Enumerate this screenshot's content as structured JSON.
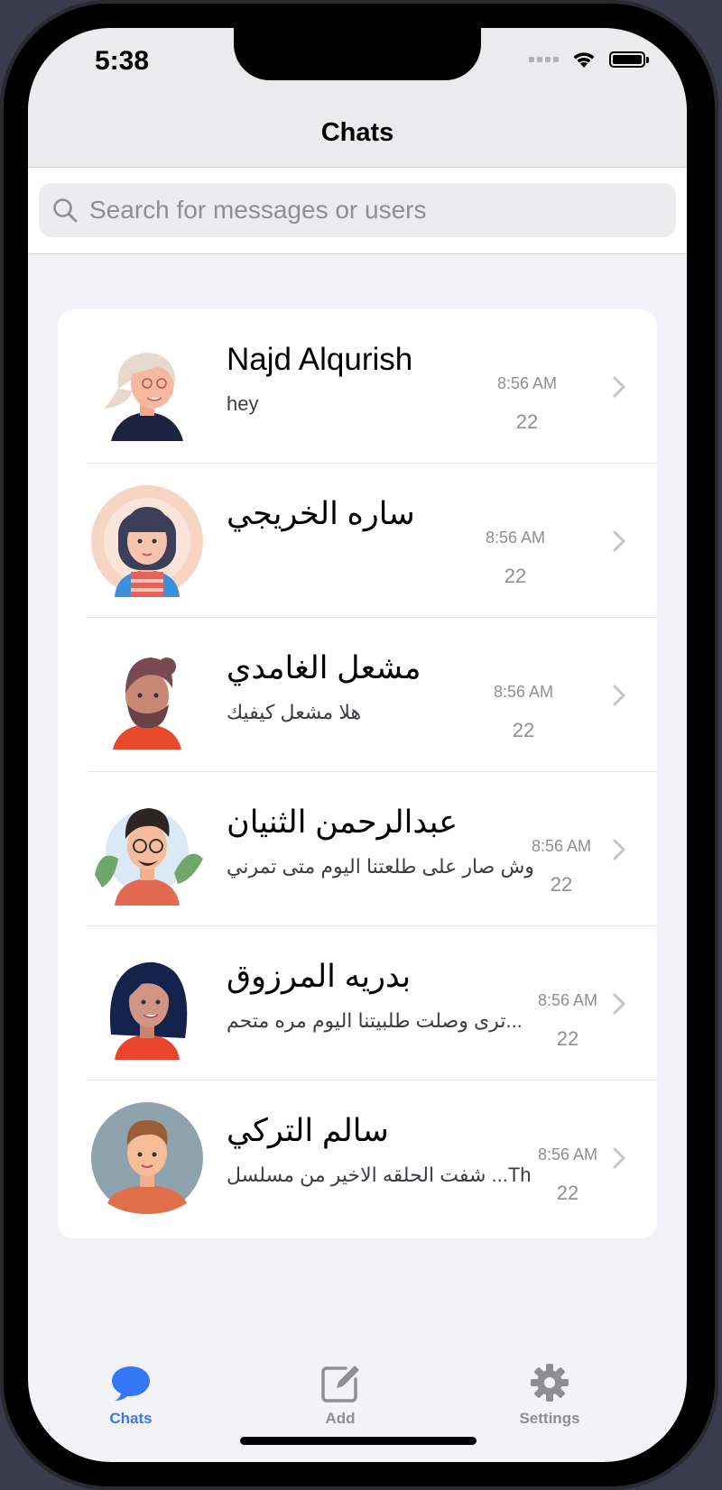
{
  "status_bar": {
    "time": "5:38"
  },
  "nav": {
    "title": "Chats"
  },
  "search": {
    "placeholder": "Search for messages or users"
  },
  "chats": [
    {
      "name": "Najd Alqurish",
      "message": "hey",
      "time": "8:56 AM",
      "count": "22",
      "avatar": "avatar-woman-blonde"
    },
    {
      "name": "ساره الخريجي",
      "message": "",
      "time": "8:56 AM",
      "count": "22",
      "avatar": "avatar-girl-bangs"
    },
    {
      "name": "مشعل الغامدي",
      "message": "هلا مشعل كيفيك",
      "time": "8:56 AM",
      "count": "22",
      "avatar": "avatar-man-beard"
    },
    {
      "name": "عبدالرحمن الثنيان",
      "message": "وش صار على طلعتنا اليوم متى تمرني",
      "time": "8:56 AM",
      "count": "22",
      "avatar": "avatar-man-glasses"
    },
    {
      "name": "بدريه المرزوق",
      "message": "ترى وصلت طلبيتنا اليوم مره متحم...",
      "time": "8:56 AM",
      "count": "22",
      "avatar": "avatar-woman-dark-hair"
    },
    {
      "name": "سالم التركي",
      "message": "شفت الحلقه الاخير من مسلسل ...Th",
      "time": "8:56 AM",
      "count": "22",
      "avatar": "avatar-man-gray-bg"
    }
  ],
  "tabs": [
    {
      "label": "Chats",
      "icon": "chat-bubble-icon",
      "active": true
    },
    {
      "label": "Add",
      "icon": "compose-icon",
      "active": false
    },
    {
      "label": "Settings",
      "icon": "gear-icon",
      "active": false
    }
  ],
  "colors": {
    "accent": "#3478f6",
    "inactive": "#8e8e93",
    "background": "#f2f2f7"
  }
}
